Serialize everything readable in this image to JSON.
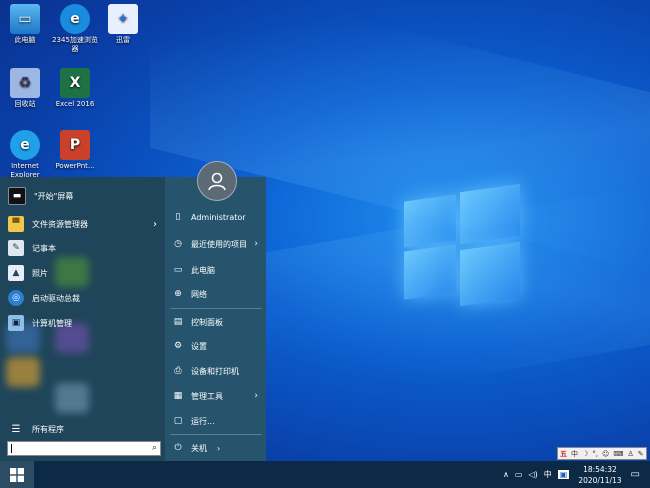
{
  "desktop": {
    "icons": [
      {
        "label": "此电脑",
        "icon": "computer-icon"
      },
      {
        "label": "2345加速浏览器",
        "icon": "browser-icon"
      },
      {
        "label": "迅雷",
        "icon": "xunlei-icon"
      },
      {
        "label": "回收站",
        "icon": "recycle-bin-icon"
      },
      {
        "label": "Excel 2016",
        "icon": "excel-icon"
      },
      {
        "label": "Internet Explorer",
        "icon": "ie-icon"
      },
      {
        "label": "PowerPnt...",
        "icon": "powerpoint-icon"
      }
    ]
  },
  "start_menu": {
    "left_items": [
      {
        "label": "\"开始\"屏幕",
        "icon": "start-screen-icon"
      },
      {
        "label": "文件资源管理器",
        "icon": "folder-icon",
        "has_submenu": true
      },
      {
        "label": "记事本",
        "icon": "notepad-icon"
      },
      {
        "label": "照片",
        "icon": "photos-icon"
      },
      {
        "label": "启动驱动总裁",
        "icon": "driver-icon"
      },
      {
        "label": "计算机管理",
        "icon": "computer-management-icon"
      }
    ],
    "all_programs": "所有程序",
    "right_items": [
      {
        "label": "Administrator",
        "icon": "user-icon"
      },
      {
        "label": "最近使用的项目",
        "icon": "clock-icon",
        "has_submenu": true
      },
      {
        "label": "此电脑",
        "icon": "computer-icon"
      },
      {
        "label": "网络",
        "icon": "network-icon"
      },
      {
        "label": "控制面板",
        "icon": "control-panel-icon"
      },
      {
        "label": "设置",
        "icon": "gear-icon"
      },
      {
        "label": "设备和打印机",
        "icon": "printer-icon"
      },
      {
        "label": "管理工具",
        "icon": "tools-icon",
        "has_submenu": true
      },
      {
        "label": "运行...",
        "icon": "run-icon"
      }
    ],
    "shutdown": "关机",
    "search_placeholder": ""
  },
  "ime": {
    "mode": "中"
  },
  "taskbar": {
    "tray": {
      "input": "中",
      "time": "18:54:32",
      "date": "2020/11/13"
    }
  }
}
